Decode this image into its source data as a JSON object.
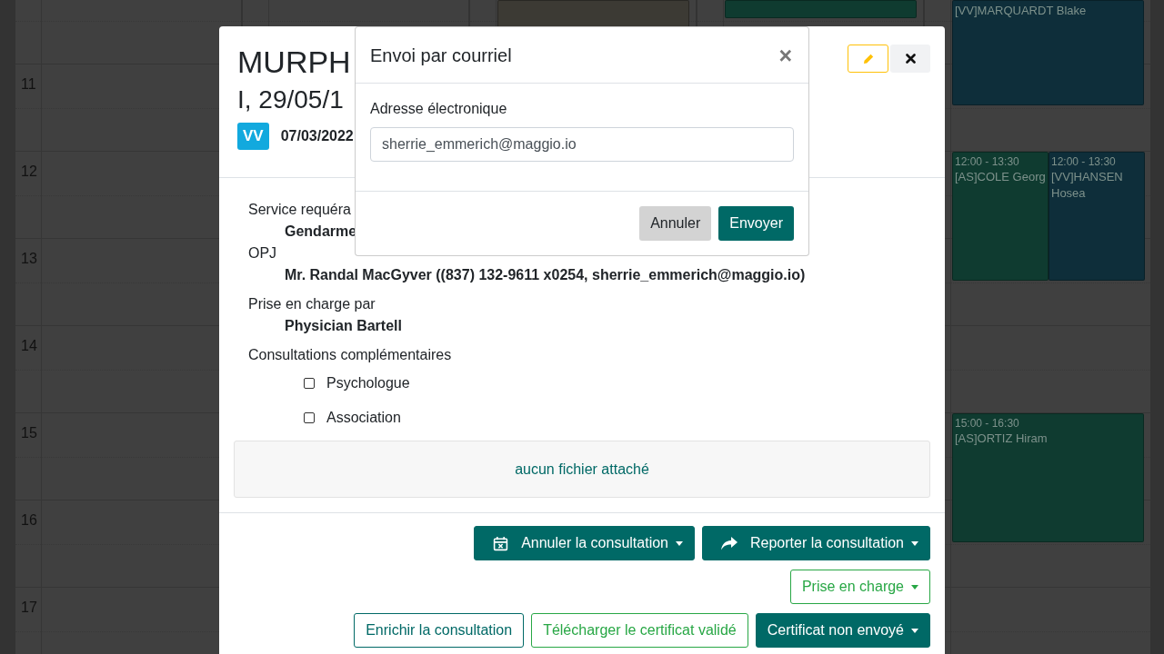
{
  "calendar": {
    "columns": [
      {
        "hour_labels": [
          "11",
          "12",
          "13",
          "14",
          "15",
          "16",
          "17"
        ]
      },
      {},
      {
        "events": [
          {
            "color": "#3c3a34"
          }
        ]
      },
      {
        "events": [
          {
            "color": "#0f3b30"
          }
        ]
      },
      {
        "events": [
          {
            "color": "#0e2e3a",
            "name": "[VV]MARQUARDT Blake"
          },
          {
            "color": "#0f3b30",
            "time": "12:00 - 13:30",
            "name": "[AS]COLE Georg"
          },
          {
            "color": "#0e2e3a",
            "time": "12:00 - 13:30",
            "name": "[VV]HANSEN Hosea"
          },
          {
            "color": "#0f3b30",
            "time": "15:00 - 16:30",
            "name": "[AS]ORTIZ Hiram"
          }
        ]
      }
    ]
  },
  "record": {
    "title": "MURPH",
    "subtitle": "I, 29/05/1",
    "badge": "VV",
    "date": "07/03/2022",
    "fields": [
      {
        "label": "Service requéra",
        "value": "Gendarme"
      },
      {
        "label": "OPJ",
        "value": "Mr. Randal MacGyver ((837) 132-9611 x0254, sherrie_emmerich@maggio.io)"
      },
      {
        "label": "Prise en charge par",
        "value": "Physician Bartell"
      }
    ],
    "extra_consultations": {
      "label": "Consultations complémentaires",
      "options": [
        {
          "label": "Psychologue",
          "checked": false
        },
        {
          "label": "Association",
          "checked": false
        }
      ]
    },
    "attachments": {
      "empty_text": "aucun fichier attaché"
    },
    "action_rows": [
      [
        {
          "label": "Annuler la consultation",
          "kind": "cancel",
          "dropdown": true
        },
        {
          "label": "Reporter la consultation",
          "kind": "postpone",
          "dropdown": true
        }
      ],
      [
        {
          "label": "Prise en charge",
          "kind": "success-outline",
          "dropdown": true
        }
      ],
      [
        {
          "label": "Enrichir la consultation",
          "kind": "outline",
          "dropdown": false
        },
        {
          "label": "Télécharger le certificat validé",
          "kind": "success-outline",
          "dropdown": false
        },
        {
          "label": "Certificat non envoyé",
          "kind": "solid",
          "dropdown": true
        }
      ]
    ]
  },
  "mail_dialog": {
    "title": "Envoi par courriel",
    "close": "×",
    "field_label": "Adresse électronique",
    "value": "sherrie_emmerich@maggio.io",
    "buttons": [
      {
        "label": "Annuler",
        "kind": "secondary"
      },
      {
        "label": "Envoyer",
        "kind": "primary"
      }
    ]
  }
}
